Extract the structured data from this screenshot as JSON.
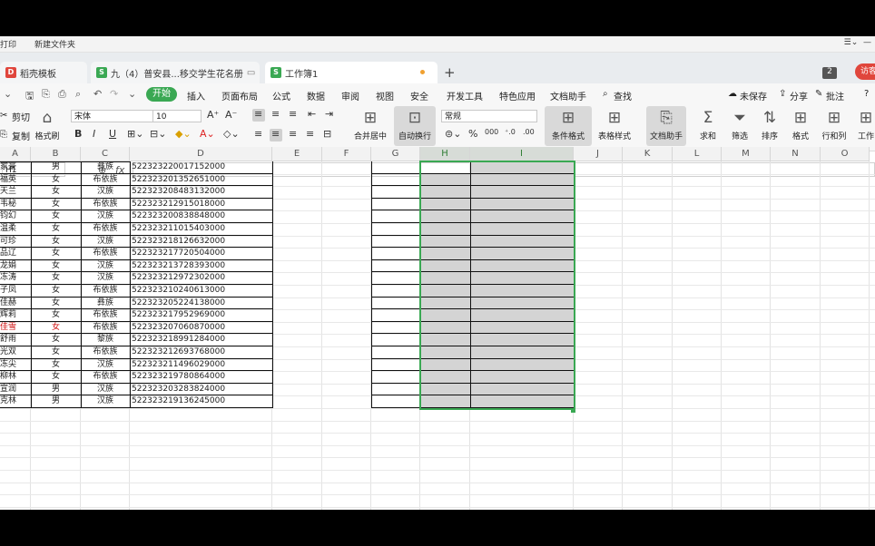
{
  "titlebar": {
    "print": "打印",
    "new_folder": "新建文件夹"
  },
  "tabs": [
    {
      "label": "稻壳模板",
      "color": "#e0463c",
      "icon": "D"
    },
    {
      "label": "九（4）普安县...移交学生花名册",
      "color": "#3aa853",
      "icon": "S"
    },
    {
      "label": "工作簿1",
      "color": "#3aa853",
      "icon": "S"
    }
  ],
  "tab_count": "2",
  "visit_label": "访客",
  "menu": {
    "start": "开始",
    "items": [
      "插入",
      "页面布局",
      "公式",
      "数据",
      "审阅",
      "视图",
      "安全",
      "开发工具",
      "特色应用",
      "文档助手"
    ],
    "search": "查找",
    "unsaved": "未保存",
    "share": "分享",
    "comment": "批注"
  },
  "ribbon": {
    "cut": "剪切",
    "copy": "复制",
    "format_painter": "格式刷",
    "font_name": "宋体",
    "font_size": "10",
    "merge_center": "合并居中",
    "wrap_text": "自动换行",
    "number_format": "常规",
    "conditional_format": "条件格式",
    "table_style": "表格样式",
    "doc_helper": "文档助手",
    "sum": "求和",
    "filter": "筛选",
    "sort": "排序",
    "format": "格式",
    "rows_cols": "行和列",
    "worksheet": "工作"
  },
  "formula_bar": {
    "cell_ref": "H1",
    "fx": "fx",
    "content": ""
  },
  "columns": [
    "A",
    "B",
    "C",
    "D",
    "E",
    "F",
    "G",
    "H",
    "I",
    "J",
    "K",
    "L",
    "M",
    "N",
    "O"
  ],
  "rows": [
    {
      "name": "家豪",
      "gender": "男",
      "ethnicity": "彝族",
      "id": "522323220017152000",
      "red": false
    },
    {
      "name": "福英",
      "gender": "女",
      "ethnicity": "布依族",
      "id": "522323201352651000",
      "red": false
    },
    {
      "name": "天兰",
      "gender": "女",
      "ethnicity": "汉族",
      "id": "522323208483132000",
      "red": false
    },
    {
      "name": "韦秘",
      "gender": "女",
      "ethnicity": "布依族",
      "id": "522323212915018000",
      "red": false
    },
    {
      "name": "钧幻",
      "gender": "女",
      "ethnicity": "汉族",
      "id": "522323200838848000",
      "red": false
    },
    {
      "name": "温柔",
      "gender": "女",
      "ethnicity": "布依族",
      "id": "522323211015403000",
      "red": false
    },
    {
      "name": "可珍",
      "gender": "女",
      "ethnicity": "汉族",
      "id": "522323218126632000",
      "red": false
    },
    {
      "name": "品辽",
      "gender": "女",
      "ethnicity": "布依族",
      "id": "522323217720504000",
      "red": false
    },
    {
      "name": "龙娟",
      "gender": "女",
      "ethnicity": "汉族",
      "id": "522323213728393000",
      "red": false
    },
    {
      "name": "冻涛",
      "gender": "女",
      "ethnicity": "汉族",
      "id": "522323212972302000",
      "red": false
    },
    {
      "name": "子凤",
      "gender": "女",
      "ethnicity": "布依族",
      "id": "522323210240613000",
      "red": false
    },
    {
      "name": "佳赫",
      "gender": "女",
      "ethnicity": "彝族",
      "id": "522323205224138000",
      "red": false
    },
    {
      "name": "辉莉",
      "gender": "女",
      "ethnicity": "布依族",
      "id": "522323217952969000",
      "red": false
    },
    {
      "name": "佳雪",
      "gender": "女",
      "ethnicity": "布依族",
      "id": "522323207060870000",
      "red": true
    },
    {
      "name": "舒雨",
      "gender": "女",
      "ethnicity": "黎族",
      "id": "522323218991284000",
      "red": false
    },
    {
      "name": "光双",
      "gender": "女",
      "ethnicity": "布依族",
      "id": "522323212693768000",
      "red": false
    },
    {
      "name": "冻尖",
      "gender": "女",
      "ethnicity": "汉族",
      "id": "522323211496029000",
      "red": false
    },
    {
      "name": "柳林",
      "gender": "女",
      "ethnicity": "布依族",
      "id": "522323219780864000",
      "red": false
    },
    {
      "name": "宣润",
      "gender": "男",
      "ethnicity": "汉族",
      "id": "522323203283824000",
      "red": false
    },
    {
      "name": "克林",
      "gender": "男",
      "ethnicity": "汉族",
      "id": "522323219136245000",
      "red": false
    }
  ]
}
